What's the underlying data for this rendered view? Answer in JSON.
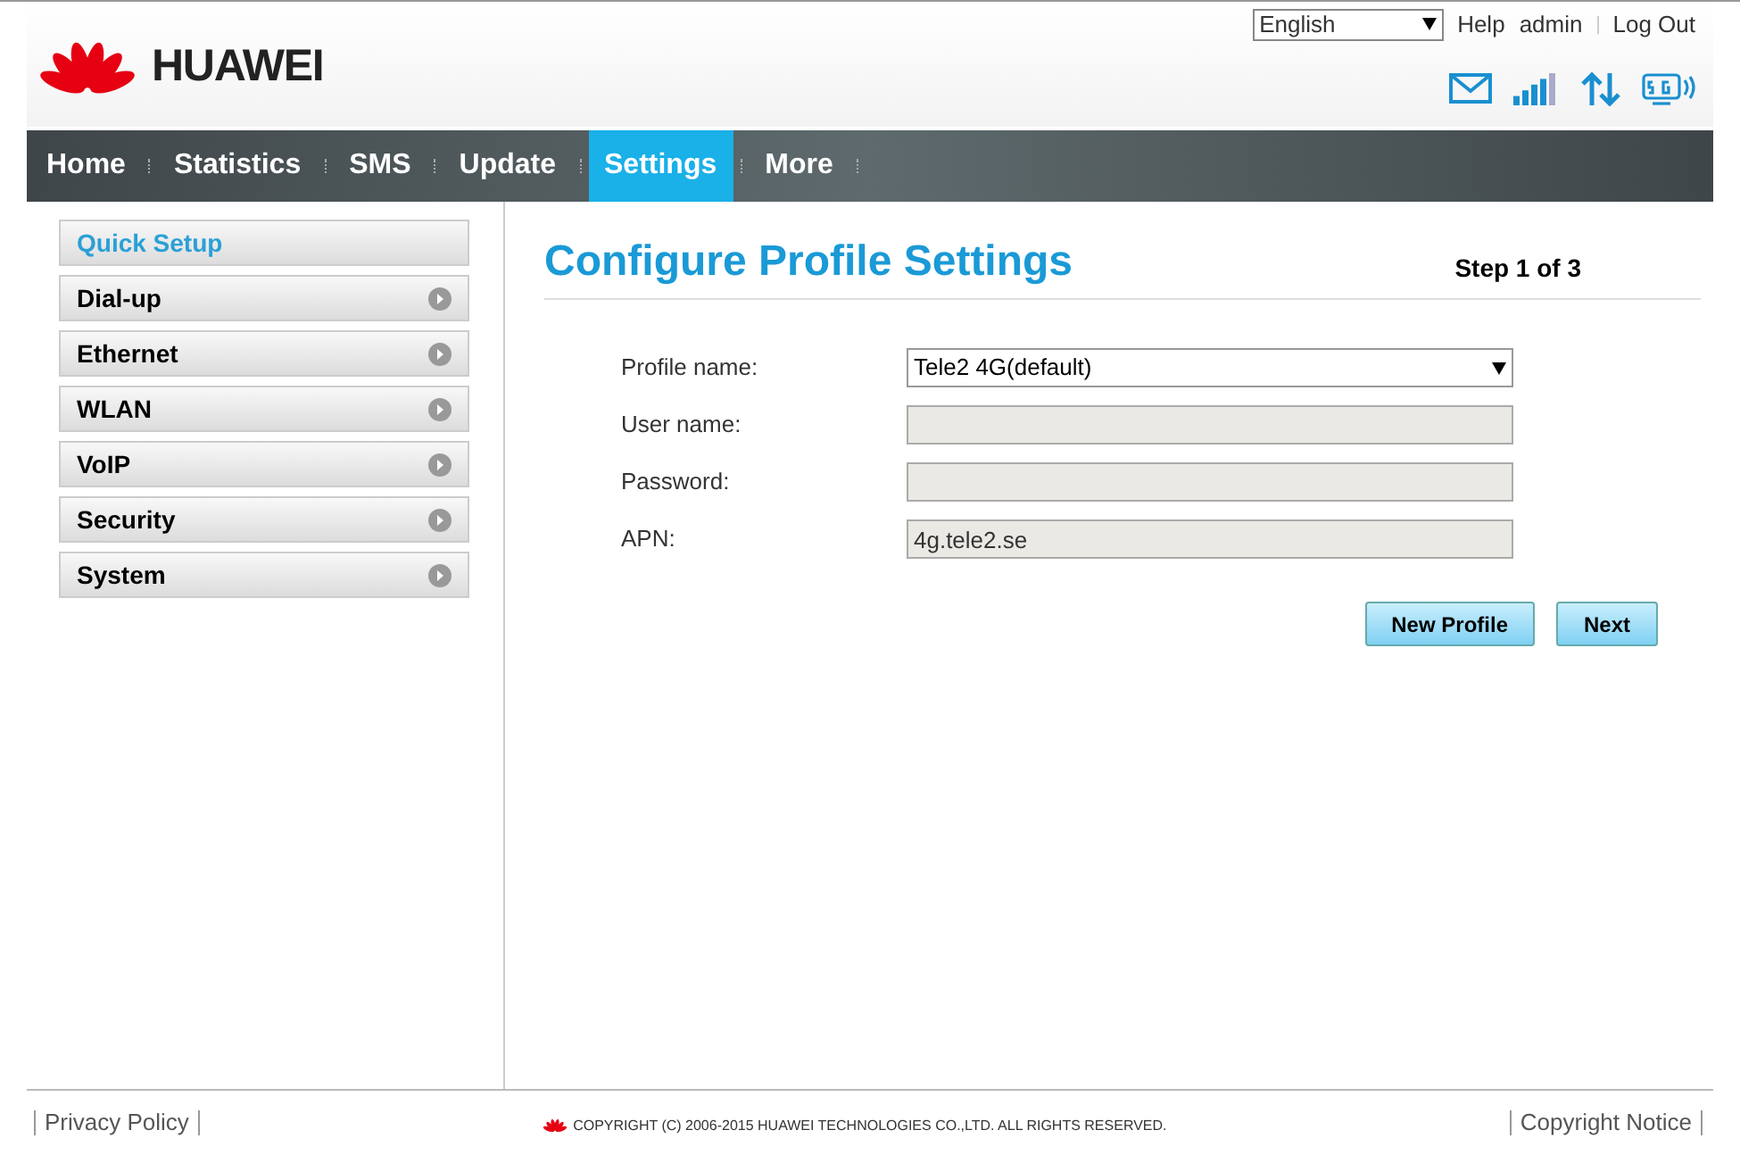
{
  "header": {
    "brand": "HUAWEI",
    "language": "English",
    "links": [
      "Help",
      "admin",
      "Log Out"
    ]
  },
  "nav": [
    {
      "label": "Home",
      "selected": false
    },
    {
      "label": "Statistics",
      "selected": false
    },
    {
      "label": "SMS",
      "selected": false
    },
    {
      "label": "Update",
      "selected": false
    },
    {
      "label": "Settings",
      "selected": true
    },
    {
      "label": "More",
      "selected": false
    }
  ],
  "sidebar": [
    {
      "label": "Quick Setup",
      "kind": "link",
      "selected": true
    },
    {
      "label": "Dial-up",
      "kind": "menu",
      "selected": false
    },
    {
      "label": "Ethernet",
      "kind": "menu",
      "selected": false
    },
    {
      "label": "WLAN",
      "kind": "menu",
      "selected": false
    },
    {
      "label": "VoIP",
      "kind": "menu",
      "selected": false
    },
    {
      "label": "Security",
      "kind": "menu",
      "selected": false
    },
    {
      "label": "System",
      "kind": "menu",
      "selected": false
    }
  ],
  "page": {
    "title": "Configure Profile Settings",
    "step": "Step 1 of 3"
  },
  "form": [
    {
      "label": "Profile name:",
      "kind": "select",
      "value": "Tele2 4G(default)"
    },
    {
      "label": "User name:",
      "kind": "input"
    },
    {
      "label": "Password:",
      "kind": "input"
    },
    {
      "label": "APN:",
      "kind": "input",
      "value": "4g.tele2.se"
    }
  ],
  "buttons": [
    "New Profile",
    "Next"
  ],
  "footer": {
    "left": "Privacy Policy",
    "copyright": "COPYRIGHT (C) 2006-2015 HUAWEI TECHNOLOGIES CO.,LTD. ALL RIGHTS RESERVED.",
    "right": "Copyright Notice"
  }
}
